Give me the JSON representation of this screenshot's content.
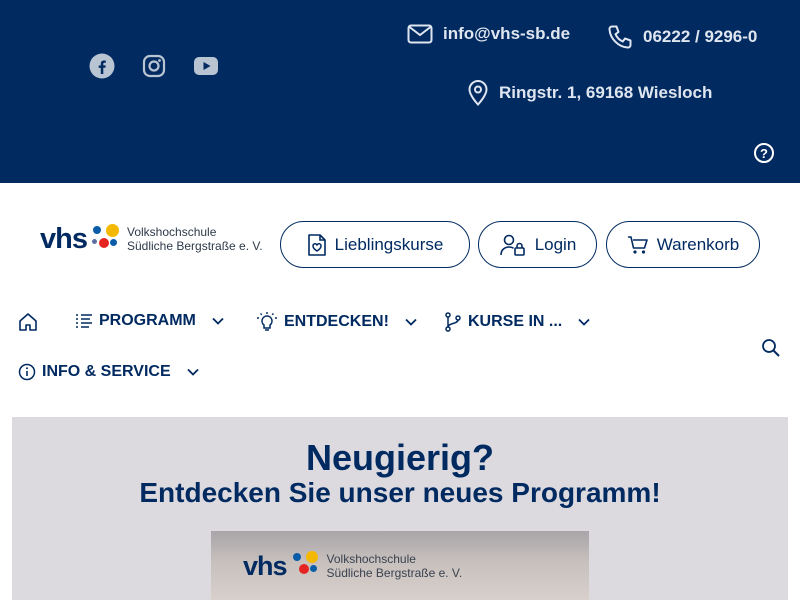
{
  "topbar": {
    "email": "info@vhs-sb.de",
    "phone": "06222 / 9296-0",
    "address": "Ringstr. 1, 69168 Wiesloch",
    "help": "?",
    "social": [
      "facebook-icon",
      "instagram-icon",
      "youtube-icon"
    ]
  },
  "logo": {
    "short": "vhs",
    "line1": "Volkshochschule",
    "line2": "Südliche Bergstraße e. V."
  },
  "header": {
    "favorites_label": "Lieblingskurse",
    "login_label": "Login",
    "cart_label": "Warenkorb"
  },
  "nav": {
    "programm": "PROGRAMM",
    "entdecken": "ENTDECKEN!",
    "kurse": "KURSE IN ...",
    "info": "INFO & SERVICE"
  },
  "hero": {
    "title": "Neugierig?",
    "subtitle": "Entdecken Sie unser neues Programm!",
    "image_logo_short": "vhs",
    "image_logo_line1": "Volkshochschule",
    "image_logo_line2": "Südliche Bergstraße e. V."
  },
  "colors": {
    "primary": "#012a61",
    "hero_bg": "#dcdadf",
    "logo_yellow": "#f5b800",
    "logo_red": "#e52421",
    "logo_blue": "#0b5ca8"
  }
}
